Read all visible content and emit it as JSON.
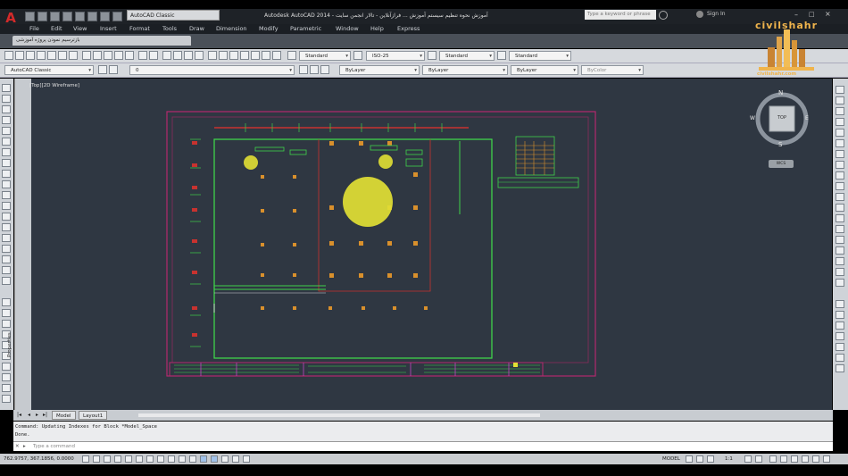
{
  "app": {
    "file_tab": "AutoCAD Classic",
    "window_title": "Autodesk AutoCAD 2014 - آموزش نحوه تنظیم سیستم آموزش ... فرازآنلاین - تالار انجمن سایت",
    "search_placeholder": "Type a keyword or phrase",
    "sign_in": "Sign In"
  },
  "menu": [
    "File",
    "Edit",
    "View",
    "Insert",
    "Format",
    "Tools",
    "Draw",
    "Dimension",
    "Modify",
    "Parametric",
    "Window",
    "Help",
    "Express"
  ],
  "ribbon": {
    "tab_label": "بازترسیم نمودن پروژه آموزشی"
  },
  "toolbar1": {
    "text_style": "Standard",
    "dim_style": "ISO-25",
    "table_style": "Standard",
    "mleader_style": "Standard"
  },
  "toolbar2": {
    "workspace": "AutoCAD Classic",
    "layer": "0",
    "color": "ByLayer",
    "linetype": "ByLayer",
    "lineweight": "ByLayer",
    "plotstyle": "ByColor"
  },
  "logo": {
    "text": "civilshahr",
    "sub": "civilshahr.com"
  },
  "viewport": {
    "label": "[Top][2D Wireframe]"
  },
  "viewcube": {
    "top": "TOP",
    "north": "N",
    "south": "S",
    "east": "E",
    "west": "W",
    "wcs": "WCS"
  },
  "palette": {
    "label": "Properties"
  },
  "layout_tabs": [
    "Model",
    "Layout1"
  ],
  "command": {
    "history_line1": "Command:  Updating Indexes for Block *Model_Space",
    "history_line2": "Done.",
    "prompt_placeholder": "Type a command"
  },
  "status": {
    "coordinates": "762.9757, 367.1856, 0.0000",
    "model_label": "MODEL",
    "scale": "1:1"
  },
  "colors": {
    "canvas_bg": "#2f3742",
    "frame": "#b4286e",
    "green_lines": "#3fd24a",
    "yellow_fill": "#e2e034",
    "red_lines": "#c8322f",
    "orange_nodes": "#d9902c"
  }
}
